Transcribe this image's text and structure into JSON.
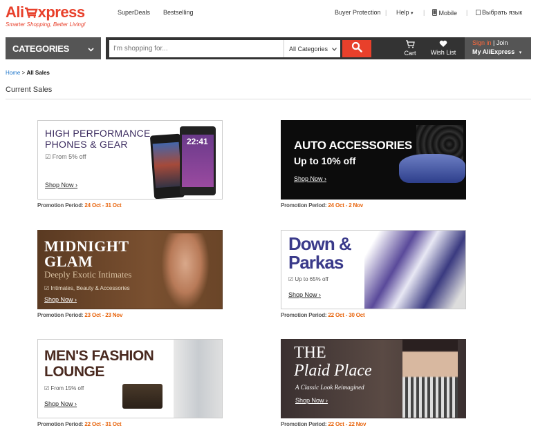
{
  "header": {
    "logo_ali": "Ali",
    "logo_express": "xpress",
    "tagline": "Smarter Shopping, Better Living!",
    "links": [
      "SuperDeals",
      "Bestselling"
    ],
    "right_links": {
      "buyer_protection": "Buyer Protection",
      "help": "Help",
      "mobile": "Mobile",
      "language": "Выбрать язык"
    }
  },
  "nav": {
    "categories": "CATEGORIES",
    "search_placeholder": "I'm shopping for...",
    "search_category": "All Categories",
    "cart": "Cart",
    "wishlist": "Wish List",
    "sign_in": "Sign in",
    "join": "Join",
    "my_aliexpress": "My AliExpress"
  },
  "breadcrumb": {
    "home": "Home",
    "sep": ">",
    "current": "All Sales"
  },
  "page_title": "Current Sales",
  "promotions": [
    {
      "title1": "HIGH PERFORMANCE",
      "title2": "PHONES & GEAR",
      "sub": "From 5% off",
      "shop": "Shop Now",
      "period_label": "Promotion Period:",
      "dates": "24 Oct - 31 Oct",
      "time": "22:41"
    },
    {
      "title1": "AUTO ACCESSORIES",
      "title2": "Up to 10% off",
      "shop": "Shop Now",
      "period_label": "Promotion Period:",
      "dates": "24 Oct - 2 Nov"
    },
    {
      "title1": "MIDNIGHT",
      "title2": "GLAM",
      "title3": "Deeply Exotic Intimates",
      "sub": "Intimates, Beauty & Accessories",
      "shop": "Shop Now",
      "period_label": "Promotion Period:",
      "dates": "23 Oct - 23 Nov"
    },
    {
      "title1": "Down &",
      "title2": "Parkas",
      "sub": "Up to 65% off",
      "shop": "Shop Now",
      "period_label": "Promotion Period:",
      "dates": "22 Oct - 30 Oct"
    },
    {
      "title1": "MEN'S FASHION",
      "title2": "LOUNGE",
      "sub": "From 15% off",
      "shop": "Shop Now",
      "period_label": "Promotion Period:",
      "dates": "22 Oct - 31 Oct"
    },
    {
      "title1": "THE",
      "title2": "Plaid Place",
      "sub": "A Classic Look Reimagined",
      "shop": "Shop Now",
      "period_label": "Promotion Period:",
      "dates": "22 Oct - 22 Nov"
    }
  ],
  "colors": {
    "brand": "#e8402b",
    "dark_bar": "#333333",
    "accent_orange": "#e8640c"
  }
}
